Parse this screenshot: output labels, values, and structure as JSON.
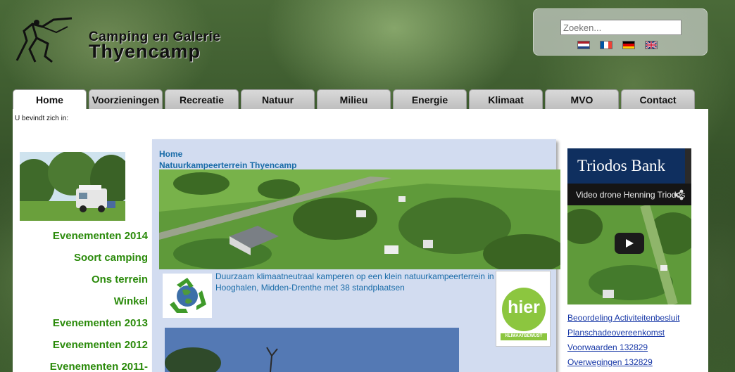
{
  "logo": {
    "line1": "Camping en Galerie",
    "line2": "Thyencamp"
  },
  "search": {
    "placeholder": "Zoeken..."
  },
  "languages": [
    "Nederlands",
    "Français",
    "Deutsch",
    "English"
  ],
  "nav": {
    "tabs": [
      {
        "label": "Home",
        "active": true
      },
      {
        "label": "Voorzieningen"
      },
      {
        "label": "Recreatie"
      },
      {
        "label": "Natuur"
      },
      {
        "label": "Milieu"
      },
      {
        "label": "Energie"
      },
      {
        "label": "Klimaat"
      },
      {
        "label": "MVO"
      },
      {
        "label": "Contact"
      }
    ]
  },
  "breadcrumb_label": "U bevindt zich in:",
  "sidebar": {
    "links": [
      "Evenementen 2014",
      "Soort camping",
      "Ons terrein",
      "Winkel",
      "Evenementen 2013",
      "Evenementen 2012",
      "Evenementen 2011-"
    ]
  },
  "main": {
    "crumb_home": "Home",
    "crumb_page": "Natuurkampeerterrein Thyencamp",
    "intro": "Duurzaam klimaatneutraal kamperen op een klein natuurkampeerterrein in Hooghalen, Midden-Drenthe met 38 standplaatsen",
    "badge_word": "hier",
    "badge_sub": "KLIMAATBEWUST"
  },
  "video": {
    "brand": "Triodos Bank",
    "title": "Video drone Henning Triodos"
  },
  "right_links": [
    "Beoordeling Activiteitenbesluit",
    "Planschadeovereenkomst",
    "Voorwaarden 132829",
    "Overwegingen 132829"
  ],
  "colors": {
    "sidebar_link": "#2a8a0a",
    "content_link": "#1a6ca8",
    "content_bg": "#d2dcf0",
    "right_link": "#1a3aa8"
  }
}
